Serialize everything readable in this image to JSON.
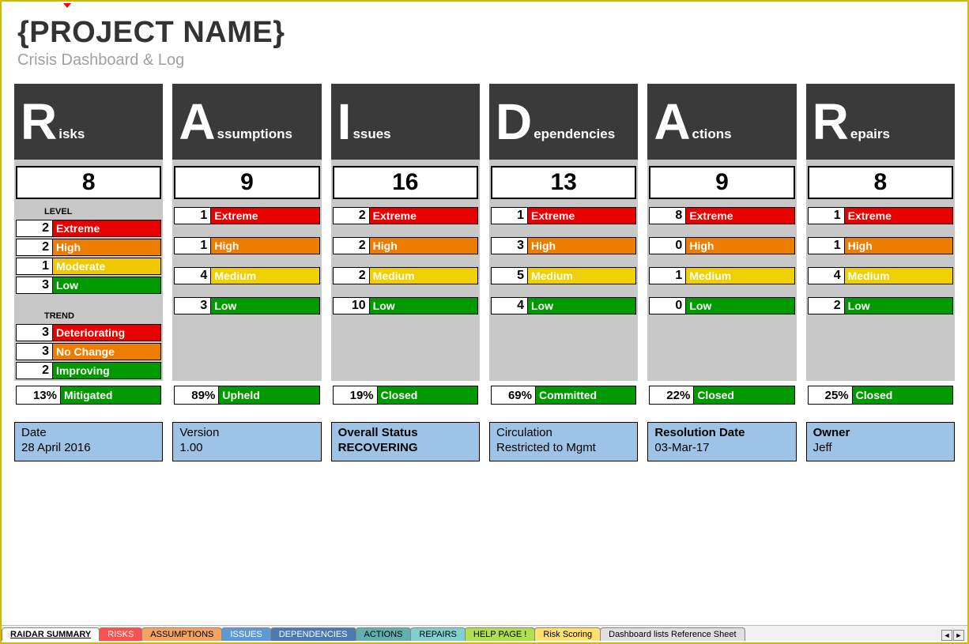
{
  "header": {
    "title": "{PROJECT NAME}",
    "subtitle": "Crisis Dashboard & Log"
  },
  "columns": [
    {
      "big": "R",
      "label": "isks",
      "count": 8
    },
    {
      "big": "A",
      "label": "ssumptions",
      "count": 9
    },
    {
      "big": "I",
      "label": "ssues",
      "count": 16
    },
    {
      "big": "D",
      "label": "ependencies",
      "count": 13
    },
    {
      "big": "A",
      "label": "ctions",
      "count": 9
    },
    {
      "big": "R",
      "label": "epairs",
      "count": 8
    }
  ],
  "risks_levels": {
    "section_label": "LEVEL",
    "rows": [
      {
        "n": 2,
        "label": "Extreme",
        "cls": "bg-extreme"
      },
      {
        "n": 2,
        "label": "High",
        "cls": "bg-high"
      },
      {
        "n": 1,
        "label": "Moderate",
        "cls": "bg-moderate"
      },
      {
        "n": 3,
        "label": "Low",
        "cls": "bg-low"
      }
    ]
  },
  "risks_trend": {
    "section_label": "TREND",
    "rows": [
      {
        "n": 3,
        "label": "Deteriorating",
        "cls": "bg-deterior"
      },
      {
        "n": 3,
        "label": "No Change",
        "cls": "bg-nochange"
      },
      {
        "n": 2,
        "label": "Improving",
        "cls": "bg-improv"
      }
    ]
  },
  "breakdown_labels": {
    "extreme": "Extreme",
    "high": "High",
    "medium": "Medium",
    "low": "Low"
  },
  "breakdowns": {
    "1": {
      "extreme": 1,
      "high": 1,
      "medium": 4,
      "low": 3
    },
    "2": {
      "extreme": 2,
      "high": 2,
      "medium": 2,
      "low": 10
    },
    "3": {
      "extreme": 1,
      "high": 3,
      "medium": 5,
      "low": 4
    },
    "4": {
      "extreme": 8,
      "high": 0,
      "medium": 1,
      "low": 0
    },
    "5": {
      "extreme": 1,
      "high": 1,
      "medium": 4,
      "low": 2
    }
  },
  "pct_rows": [
    {
      "pct": "13%",
      "label": "Mitigated"
    },
    {
      "pct": "89%",
      "label": "Upheld"
    },
    {
      "pct": "19%",
      "label": "Closed"
    },
    {
      "pct": "69%",
      "label": "Committed"
    },
    {
      "pct": "22%",
      "label": "Closed"
    },
    {
      "pct": "25%",
      "label": "Closed"
    }
  ],
  "footer": [
    {
      "label": "Date",
      "value": "28 April 2016"
    },
    {
      "label": "Version",
      "value": "1.00"
    },
    {
      "label": "Overall Status",
      "value": "RECOVERING",
      "bold": true
    },
    {
      "label": "Circulation",
      "value": "Restricted to Mgmt"
    },
    {
      "label": "Resolution Date",
      "value": "03-Mar-17"
    },
    {
      "label": "Owner",
      "value": "Jeff"
    }
  ],
  "tabs": [
    "RAIDAR SUMMARY",
    "RISKS",
    "ASSUMPTIONS",
    "ISSUES",
    "DEPENDENCIES",
    "ACTIONS",
    "REPAIRS",
    "HELP PAGE !",
    "Risk Scoring",
    "Dashboard lists Reference Sheet"
  ]
}
